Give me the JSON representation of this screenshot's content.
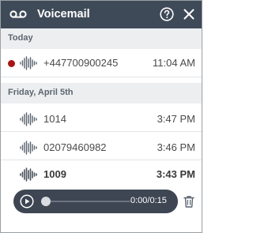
{
  "header": {
    "title": "Voicemail",
    "icons": [
      "voicemail-icon",
      "help-icon",
      "close-icon"
    ],
    "background": "#3f4a59"
  },
  "sections": [
    {
      "label": "Today",
      "items": [
        {
          "number": "+447700900245",
          "time": "11:04 AM",
          "unread": true
        }
      ]
    },
    {
      "label": "Friday, April 5th",
      "items": [
        {
          "number": "1014",
          "time": "3:47 PM",
          "unread": false
        },
        {
          "number": "02079460982",
          "time": "3:46 PM",
          "unread": false
        },
        {
          "number": "1009",
          "time": "3:43 PM",
          "unread": false,
          "selected": true
        }
      ]
    }
  ],
  "player": {
    "time": "0:00/0:15",
    "progress": 0,
    "icons": [
      "play-icon",
      "trash-icon"
    ]
  },
  "colors": {
    "unread_dot": "#a81515",
    "player_bg": "#3d4652",
    "section_bg": "#eceef0"
  }
}
